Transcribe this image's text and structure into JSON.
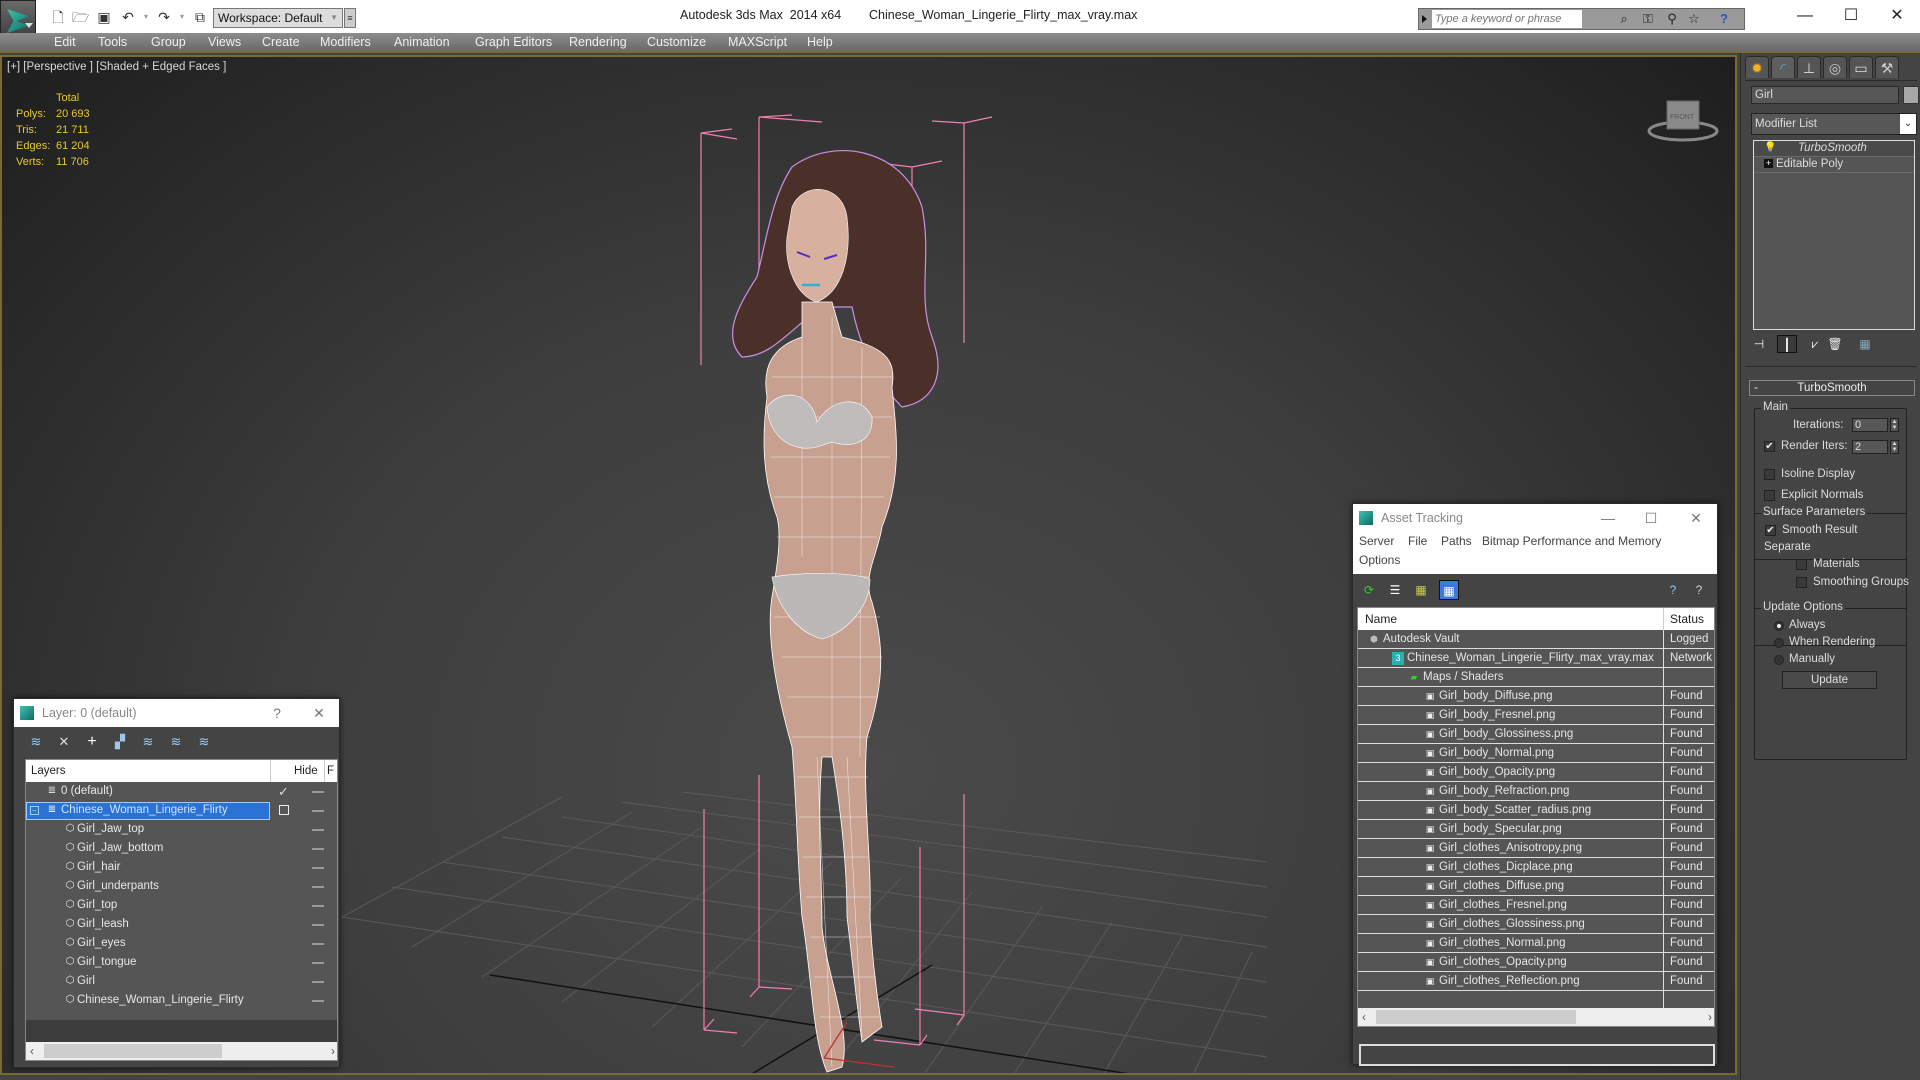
{
  "titlebar": {
    "app_name": "Autodesk 3ds Max  2014 x64",
    "file_name": "Chinese_Woman_Lingerie_Flirty_max_vray.max",
    "workspace": "Workspace: Default",
    "search_placeholder": "Type a keyword or phrase",
    "quick_access_icons": [
      "new-file-icon",
      "open-file-icon",
      "save-icon",
      "undo-icon",
      "redo-icon",
      "project-folder-icon"
    ],
    "search_icons": [
      "binoculars-icon",
      "key-icon",
      "satellite-icon",
      "star-icon",
      "help-icon"
    ],
    "window_controls": [
      "minimize",
      "maximize",
      "close"
    ]
  },
  "menu": [
    "Edit",
    "Tools",
    "Group",
    "Views",
    "Create",
    "Modifiers",
    "Animation",
    "Graph Editors",
    "Rendering",
    "Customize",
    "MAXScript",
    "Help"
  ],
  "viewport": {
    "label": "[+] [Perspective ] [Shaded + Edged Faces ]",
    "stats_header": "Total",
    "stats": [
      {
        "label": "Polys:",
        "value": "20 693"
      },
      {
        "label": "Tris:",
        "value": "21 711"
      },
      {
        "label": "Edges:",
        "value": "61 204"
      },
      {
        "label": "Verts:",
        "value": "11 706"
      }
    ],
    "viewcube_face": "FRONT"
  },
  "command_panel": {
    "tabs": [
      "create-tab",
      "modify-tab",
      "hierarchy-tab",
      "motion-tab",
      "display-tab",
      "utilities-tab"
    ],
    "object_name": "Girl",
    "modifier_list_label": "Modifier List",
    "stack": [
      {
        "label": "TurboSmooth",
        "selected": true
      },
      {
        "label": "Editable Poly",
        "selected": false
      }
    ],
    "rollout": {
      "title": "TurboSmooth",
      "main_group": "Main",
      "iterations_label": "Iterations:",
      "iterations_value": "0",
      "render_iters_label": "Render Iters:",
      "render_iters_value": "2",
      "render_iters_checked": true,
      "isoline_label": "Isoline Display",
      "isoline_checked": false,
      "explicit_normals_label": "Explicit Normals",
      "explicit_normals_checked": false,
      "surface_group": "Surface Parameters",
      "smooth_result_label": "Smooth Result",
      "smooth_result_checked": true,
      "separate_label": "Separate",
      "materials_label": "Materials",
      "smoothing_groups_label": "Smoothing Groups",
      "update_group": "Update Options",
      "update_options": [
        "Always",
        "When Rendering",
        "Manually"
      ],
      "update_selected": "Always",
      "update_button": "Update"
    }
  },
  "layer_window": {
    "title": "Layer: 0 (default)",
    "help": "?",
    "col_layers": "Layers",
    "col_hide": "Hide",
    "col_freeze": "F",
    "rows": [
      {
        "name": "0 (default)",
        "type": "layer",
        "current": true
      },
      {
        "name": "Chinese_Woman_Lingerie_Flirty",
        "type": "layer",
        "selected": true
      },
      {
        "name": "Girl_Jaw_top",
        "type": "object"
      },
      {
        "name": "Girl_Jaw_bottom",
        "type": "object"
      },
      {
        "name": "Girl_hair",
        "type": "object"
      },
      {
        "name": "Girl_underpants",
        "type": "object"
      },
      {
        "name": "Girl_top",
        "type": "object"
      },
      {
        "name": "Girl_leash",
        "type": "object"
      },
      {
        "name": "Girl_eyes",
        "type": "object"
      },
      {
        "name": "Girl_tongue",
        "type": "object"
      },
      {
        "name": "Girl",
        "type": "object"
      },
      {
        "name": "Chinese_Woman_Lingerie_Flirty",
        "type": "object"
      }
    ]
  },
  "asset_window": {
    "title": "Asset Tracking",
    "menu": [
      "Server",
      "File",
      "Paths",
      "Bitmap Performance and Memory",
      "Options"
    ],
    "col_name": "Name",
    "col_status": "Status",
    "rows": [
      {
        "name": "Autodesk Vault",
        "status": "Logged",
        "level": 1,
        "icon": "vault"
      },
      {
        "name": "Chinese_Woman_Lingerie_Flirty_max_vray.max",
        "status": "Network",
        "level": 2,
        "icon": "max"
      },
      {
        "name": "Maps / Shaders",
        "status": "",
        "level": 3,
        "icon": "maps"
      },
      {
        "name": "Girl_body_Diffuse.png",
        "status": "Found",
        "level": 4,
        "icon": "bitmap"
      },
      {
        "name": "Girl_body_Fresnel.png",
        "status": "Found",
        "level": 4,
        "icon": "bitmap"
      },
      {
        "name": "Girl_body_Glossiness.png",
        "status": "Found",
        "level": 4,
        "icon": "bitmap"
      },
      {
        "name": "Girl_body_Normal.png",
        "status": "Found",
        "level": 4,
        "icon": "bitmap"
      },
      {
        "name": "Girl_body_Opacity.png",
        "status": "Found",
        "level": 4,
        "icon": "bitmap"
      },
      {
        "name": "Girl_body_Refraction.png",
        "status": "Found",
        "level": 4,
        "icon": "bitmap"
      },
      {
        "name": "Girl_body_Scatter_radius.png",
        "status": "Found",
        "level": 4,
        "icon": "bitmap"
      },
      {
        "name": "Girl_body_Specular.png",
        "status": "Found",
        "level": 4,
        "icon": "bitmap"
      },
      {
        "name": "Girl_clothes_Anisotropy.png",
        "status": "Found",
        "level": 4,
        "icon": "bitmap"
      },
      {
        "name": "Girl_clothes_Dicplace.png",
        "status": "Found",
        "level": 4,
        "icon": "bitmap"
      },
      {
        "name": "Girl_clothes_Diffuse.png",
        "status": "Found",
        "level": 4,
        "icon": "bitmap"
      },
      {
        "name": "Girl_clothes_Fresnel.png",
        "status": "Found",
        "level": 4,
        "icon": "bitmap"
      },
      {
        "name": "Girl_clothes_Glossiness.png",
        "status": "Found",
        "level": 4,
        "icon": "bitmap"
      },
      {
        "name": "Girl_clothes_Normal.png",
        "status": "Found",
        "level": 4,
        "icon": "bitmap"
      },
      {
        "name": "Girl_clothes_Opacity.png",
        "status": "Found",
        "level": 4,
        "icon": "bitmap"
      },
      {
        "name": "Girl_clothes_Reflection.png",
        "status": "Found",
        "level": 4,
        "icon": "bitmap"
      }
    ]
  },
  "colors": {
    "accent_gold": "#7a6a30",
    "stats_yellow": "#e8c830",
    "selection_blue": "#2a73d4",
    "bbox_pink": "#f080b0",
    "hair_wire": "#c890e8"
  }
}
